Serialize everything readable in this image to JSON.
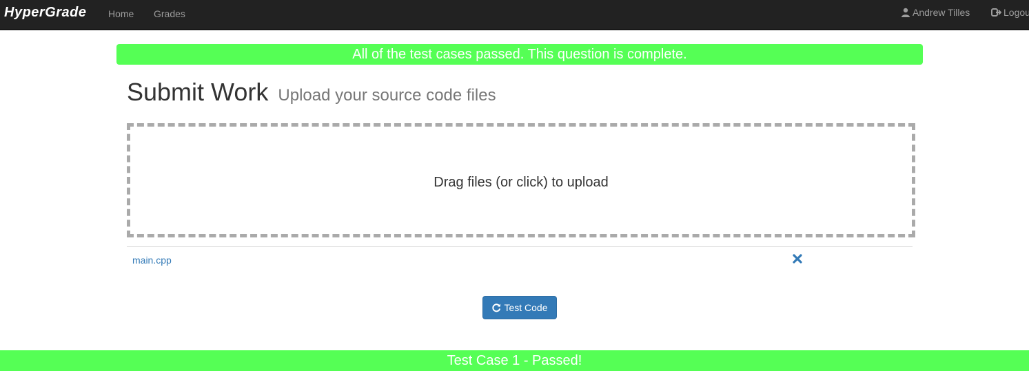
{
  "navbar": {
    "brand": "HyperGrade",
    "links": [
      "Home",
      "Grades"
    ],
    "user_name": "Andrew Tilles",
    "logout_label": "Logout"
  },
  "alert": {
    "message": "All of the test cases passed. This question is complete."
  },
  "page": {
    "title": "Submit Work",
    "subtitle": "Upload your source code files"
  },
  "dropzone": {
    "message": "Drag files (or click) to upload"
  },
  "files": [
    {
      "name": "main.cpp"
    }
  ],
  "actions": {
    "test_code_label": "Test Code"
  },
  "results": [
    {
      "label": "Test Case 1 - Passed!"
    }
  ],
  "colors": {
    "navbar_bg": "#222222",
    "success": "#55ff55",
    "primary": "#337ab7",
    "dropzone_border": "#aaaaaa"
  }
}
